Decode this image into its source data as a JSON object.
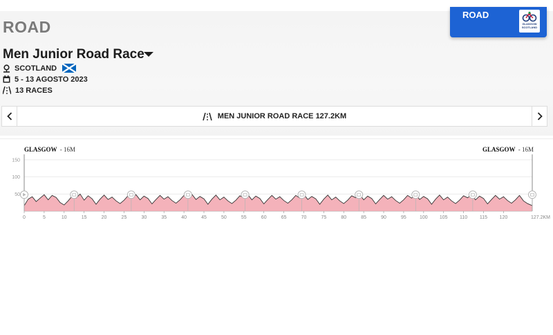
{
  "section": {
    "title": "ROAD"
  },
  "race": {
    "title": "Men Junior Road Race"
  },
  "info": {
    "location": "SCOTLAND",
    "dates": "5 - 13 AGOSTO 2023",
    "races": "13 RACES"
  },
  "brand": {
    "label": "ROAD",
    "logo_text_1": "GLASGOW",
    "logo_text_2": "SCOTLAND"
  },
  "selector": {
    "label": "MEN JUNIOR ROAD RACE 127.2KM",
    "prev_icon": "chevron-left-icon",
    "next_icon": "chevron-right-icon"
  },
  "icons": {
    "location": "location-pin-icon",
    "calendar": "calendar-icon",
    "races": "road-icon",
    "flag": "scotland-flag-icon"
  },
  "colors": {
    "brand_blue": "#1d63d4",
    "profile_fill": "#f2a5ae",
    "profile_line": "#333333",
    "scotland_blue": "#0065bd"
  },
  "chart_data": {
    "type": "area",
    "title": "",
    "xlabel": "",
    "ylabel": "",
    "x_unit": "KM",
    "xlim": [
      0,
      127.2
    ],
    "ylim": [
      0,
      170
    ],
    "yticks": [
      0,
      50,
      100,
      150
    ],
    "xticks": [
      0,
      5,
      10,
      15,
      20,
      25,
      30,
      35,
      40,
      45,
      50,
      55,
      60,
      65,
      70,
      75,
      80,
      85,
      90,
      95,
      100,
      105,
      110,
      115,
      120
    ],
    "xtick_labels": [
      "0",
      "5",
      "10",
      "15",
      "20",
      "25",
      "30",
      "35",
      "40",
      "45",
      "50",
      "55",
      "60",
      "65",
      "70",
      "75",
      "80",
      "85",
      "90",
      "95",
      "100",
      "105",
      "110",
      "115",
      "120"
    ],
    "x_end_label": "127.2KM",
    "start": {
      "label": "GLASGOW",
      "elevation_label": "16M"
    },
    "finish": {
      "label": "GLASGOW",
      "elevation_label": "16M"
    },
    "series": [
      {
        "x": [
          0,
          1,
          2,
          3,
          4,
          5,
          6,
          7,
          8,
          9,
          10,
          11,
          12,
          13,
          14,
          15,
          16,
          17,
          18,
          19,
          20,
          21,
          22,
          23,
          24,
          25,
          26,
          27,
          28,
          29,
          30,
          31,
          32,
          33,
          34,
          35,
          36,
          37,
          38,
          39,
          40,
          41,
          42,
          43,
          44,
          45,
          46,
          47,
          48,
          49,
          50,
          51,
          52,
          53,
          54,
          55,
          56,
          57,
          58,
          59,
          60,
          61,
          62,
          63,
          64,
          65,
          66,
          67,
          68,
          69,
          70,
          71,
          72,
          73,
          74,
          75,
          76,
          77,
          78,
          79,
          80,
          81,
          82,
          83,
          84,
          85,
          86,
          87,
          88,
          89,
          90,
          91,
          92,
          93,
          94,
          95,
          96,
          97,
          98,
          99,
          100,
          101,
          102,
          103,
          104,
          105,
          106,
          107,
          108,
          109,
          110,
          111,
          112,
          113,
          114,
          115,
          116,
          117,
          118,
          119,
          120,
          121,
          122,
          123,
          124,
          125,
          126,
          127.2
        ],
        "values": [
          16,
          35,
          42,
          28,
          38,
          48,
          33,
          46,
          40,
          25,
          18,
          30,
          44,
          38,
          50,
          32,
          45,
          36,
          20,
          35,
          47,
          34,
          41,
          30,
          22,
          32,
          45,
          39,
          48,
          33,
          44,
          37,
          21,
          34,
          46,
          35,
          42,
          31,
          23,
          33,
          46,
          38,
          49,
          34,
          43,
          36,
          20,
          35,
          47,
          33,
          41,
          30,
          22,
          32,
          45,
          39,
          48,
          33,
          44,
          37,
          21,
          34,
          46,
          35,
          42,
          31,
          23,
          33,
          46,
          38,
          49,
          34,
          43,
          36,
          20,
          35,
          47,
          33,
          41,
          30,
          22,
          32,
          45,
          39,
          48,
          33,
          44,
          37,
          21,
          34,
          46,
          35,
          42,
          31,
          23,
          33,
          46,
          38,
          49,
          34,
          43,
          36,
          20,
          35,
          47,
          33,
          41,
          30,
          22,
          32,
          45,
          39,
          48,
          33,
          44,
          37,
          21,
          34,
          46,
          35,
          42,
          31,
          23,
          33,
          46,
          30,
          22,
          16
        ]
      }
    ],
    "markers_km": [
      0,
      12.5,
      26.8,
      41.0,
      55.3,
      69.5,
      83.8,
      98.0,
      112.3,
      127.2
    ],
    "grid": "horizontal"
  }
}
